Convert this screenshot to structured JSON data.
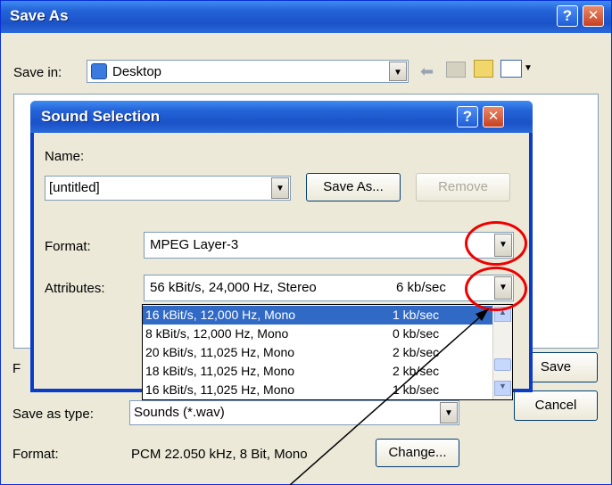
{
  "save_as": {
    "title": "Save As",
    "help_label": "?",
    "close_label": "✕",
    "save_in_label": "Save in:",
    "save_in_value": "Desktop",
    "save_button": "Save",
    "cancel_button": "Cancel",
    "file_name_label_partial": "F",
    "save_as_type_label": "Save as type:",
    "save_as_type_value": "Sounds (*.wav)",
    "format_label": "Format:",
    "format_value": "PCM 22.050 kHz, 8 Bit, Mono",
    "change_button": "Change..."
  },
  "sound_selection": {
    "title": "Sound Selection",
    "help_label": "?",
    "close_label": "✕",
    "name_label": "Name:",
    "name_value": "[untitled]",
    "save_as_button": "Save As...",
    "remove_button": "Remove",
    "format_label": "Format:",
    "format_value": "MPEG Layer-3",
    "attributes_label": "Attributes:",
    "attributes_value": "56 kBit/s, 24,000 Hz, Stereo",
    "attributes_rate": "6 kb/sec",
    "dropdown_items": [
      {
        "attr": "16 kBit/s, 12,000 Hz, Mono",
        "rate": "1 kb/sec",
        "selected": true
      },
      {
        "attr": "8 kBit/s, 12,000 Hz, Mono",
        "rate": "0 kb/sec",
        "selected": false
      },
      {
        "attr": "20 kBit/s, 11,025 Hz, Mono",
        "rate": "2 kb/sec",
        "selected": false
      },
      {
        "attr": "18 kBit/s, 11,025 Hz, Mono",
        "rate": "2 kb/sec",
        "selected": false
      },
      {
        "attr": "16 kBit/s, 11,025 Hz, Mono",
        "rate": "1 kb/sec",
        "selected": false
      }
    ]
  },
  "colors": {
    "titlebar": "#2463d8",
    "selection": "#316ac5",
    "annotation": "#ee0000"
  }
}
